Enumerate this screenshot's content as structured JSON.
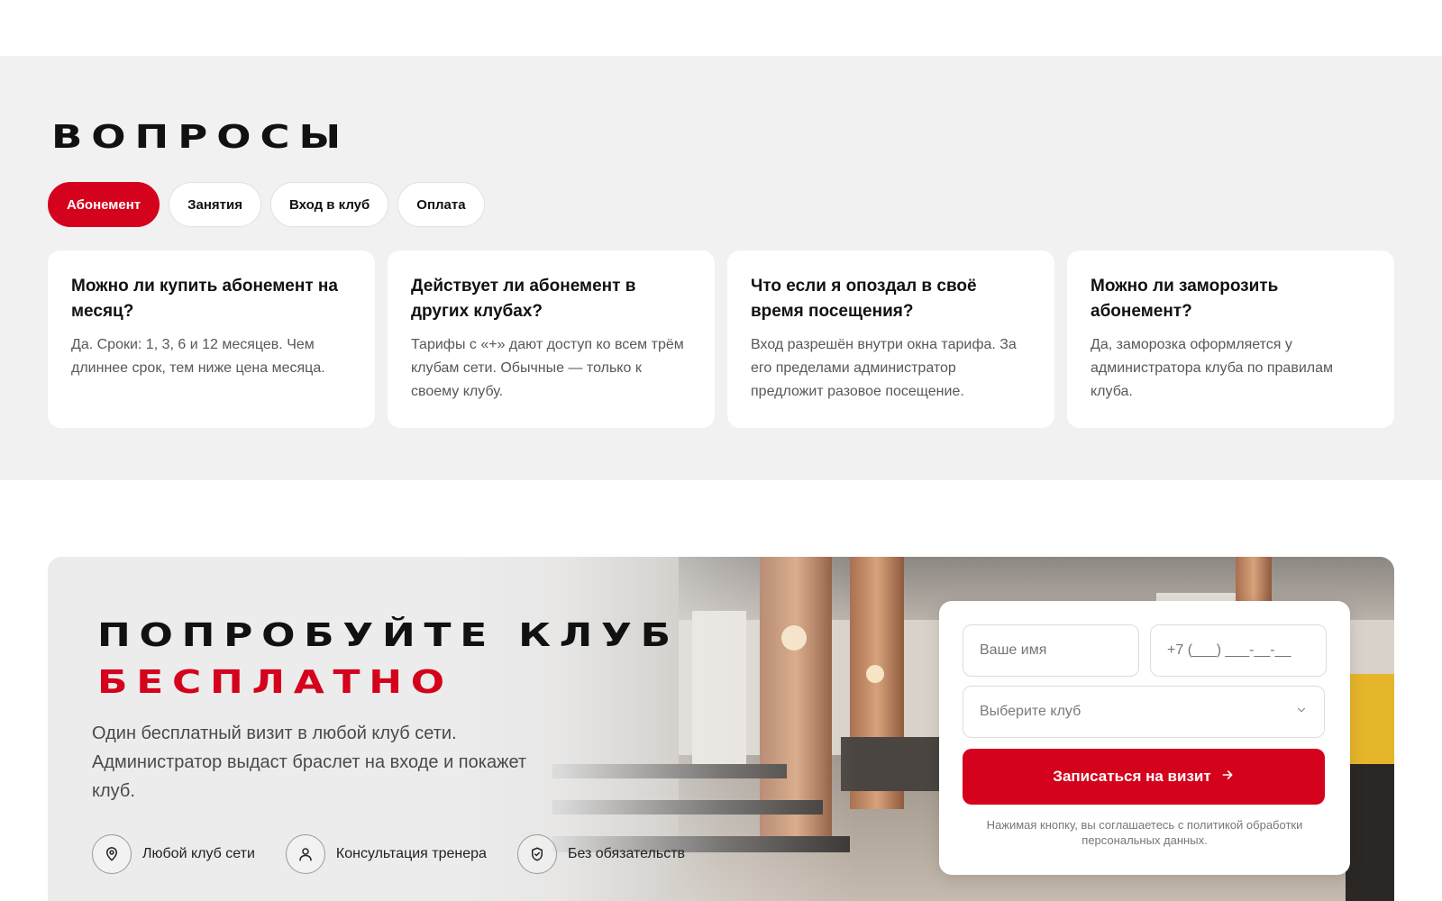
{
  "faq": {
    "title": "Вопросы",
    "tabs": [
      {
        "label": "Абонемент",
        "active": true
      },
      {
        "label": "Занятия",
        "active": false
      },
      {
        "label": "Вход в клуб",
        "active": false
      },
      {
        "label": "Оплата",
        "active": false
      }
    ],
    "cards": [
      {
        "question": "Можно ли купить абонемент на месяц?",
        "answer": "Да. Сроки: 1, 3, 6 и 12 месяцев. Чем длиннее срок, тем ниже цена месяца."
      },
      {
        "question": "Действует ли абонемент в других клубах?",
        "answer": "Тарифы с «+» дают доступ ко всем трём клубам сети. Обычные — только к своему клубу."
      },
      {
        "question": "Что если я опоздал в своё время посещения?",
        "answer": "Вход разрешён внутри окна тарифа. За его пределами администратор предложит разовое посещение."
      },
      {
        "question": "Можно ли заморозить абонемент?",
        "answer": "Да, заморозка оформляется у администратора клуба по правилам клуба."
      }
    ]
  },
  "trial": {
    "title_line1": "Попробуйте клуб",
    "title_line2": "бесплатно",
    "description": "Один бесплатный визит в любой клуб сети. Администратор выдаст браслет на входе и покажет клуб.",
    "features": [
      {
        "icon": "location-pin-icon",
        "label": "Любой клуб сети"
      },
      {
        "icon": "user-icon",
        "label": "Консультация тренера"
      },
      {
        "icon": "shield-check-icon",
        "label": "Без обязательств"
      }
    ],
    "form": {
      "name_placeholder": "Ваше имя",
      "phone_placeholder": "+7 (___) ___-__-__",
      "club_placeholder": "Выберите клуб",
      "submit_label": "Записаться на визит",
      "disclaimer": "Нажимая кнопку, вы соглашаетесь с политикой обработки персональных данных."
    }
  },
  "colors": {
    "accent": "#d4021c",
    "section_bg": "#f1f1f1",
    "text": "#111111",
    "muted_text": "#585858"
  }
}
